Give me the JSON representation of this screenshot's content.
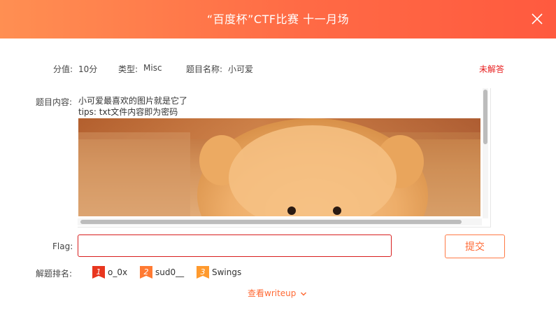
{
  "header": {
    "title": "“百度杯”CTF比赛 十一月场",
    "gradient_start": "#ff8f52",
    "gradient_end": "#ff5a3f"
  },
  "meta": {
    "score_label": "分值:",
    "score_value": "10分",
    "type_label": "类型:",
    "type_value": "Misc",
    "name_label": "题目名称:",
    "name_value": "小可爱",
    "status": "未解答",
    "status_color": "#e81f1f"
  },
  "content": {
    "label": "题目内容:",
    "line1": "小可爱最喜欢的图片就是它了",
    "line2": "tips:  txt文件内容即为密码"
  },
  "flag": {
    "label": "Flag:",
    "value": "",
    "placeholder": "",
    "submit_label": "提交"
  },
  "ranking": {
    "label": "解题排名:",
    "items": [
      {
        "rank": "1",
        "name": "o_0x",
        "color": "#e8361f"
      },
      {
        "rank": "2",
        "name": "sud0__",
        "color": "#ff7a33"
      },
      {
        "rank": "3",
        "name": "Swings",
        "color": "#ff9a2e"
      }
    ]
  },
  "writeup_link": "查看writeup",
  "icons": {
    "close": "close-icon",
    "chevron": "chevron-down-icon"
  }
}
